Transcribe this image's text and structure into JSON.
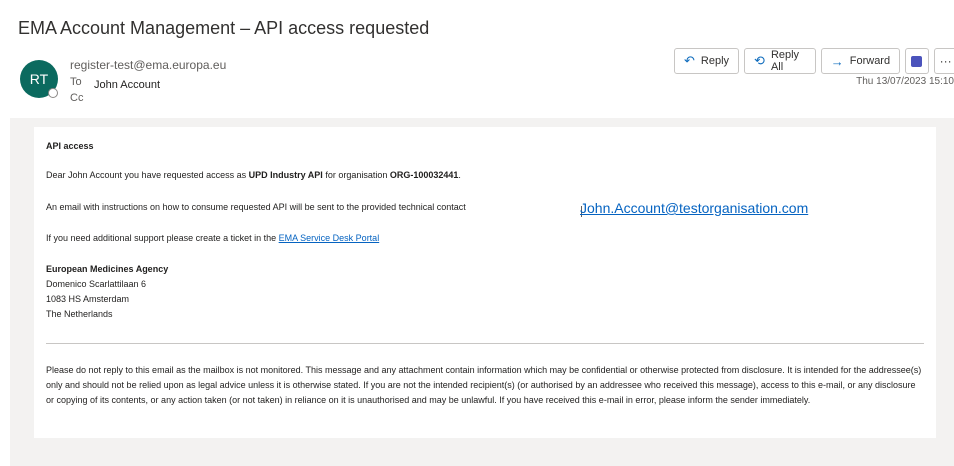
{
  "email": {
    "subject": "EMA Account Management – API access requested",
    "avatar_initials": "RT",
    "from": "register-test@ema.europa.eu",
    "to_label": "To",
    "cc_label": "Cc",
    "to_value": "John Account",
    "date": "Thu 13/07/2023 15:10"
  },
  "actions": {
    "reply": "Reply",
    "reply_all": "Reply All",
    "forward": "Forward"
  },
  "body": {
    "heading": "API access",
    "greeting_pre": "Dear John Account you have requested access as ",
    "greeting_role": "UPD Industry API",
    "greeting_mid": " for organisation ",
    "greeting_org": "ORG-100032441",
    "greeting_end": ".",
    "instructions": "An email with instructions on how to consume requested API will be sent to the provided technical contact",
    "contact_email": "John.Account@testorganisation.com",
    "support_pre": "If you need additional support please create a ticket in the ",
    "support_link": "EMA Service Desk Portal",
    "org_name": "European Medicines Agency",
    "address_1": "Domenico Scarlattilaan 6",
    "address_2": "1083 HS Amsterdam",
    "address_3": "The Netherlands",
    "disclaimer": "Please do not reply to this email as the mailbox is not monitored. This message and any attachment contain information which may be confidential or otherwise protected from disclosure. It is intended for the addressee(s) only and should not be relied upon as legal advice unless it is otherwise stated. If you are not the intended recipient(s) (or authorised by an addressee who received this message), access to this e-mail, or any disclosure or copying of its contents, or any action taken (or not taken) in reliance on it is unauthorised and may be unlawful. If you have received this e-mail in error, please inform the sender immediately."
  }
}
